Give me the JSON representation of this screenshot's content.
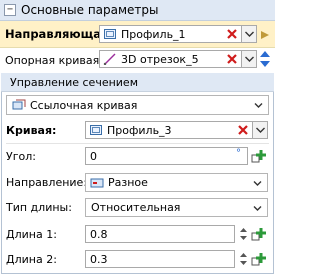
{
  "header": {
    "toggle_glyph": "−",
    "title": "Основные параметры"
  },
  "path": {
    "label": "Направляющая:",
    "value": "Профиль_1"
  },
  "reference_curve": {
    "label": "Опорная кривая:",
    "value": "3D отрезок_5"
  },
  "section": {
    "title": "Управление сечением",
    "mode_value": "Ссылочная кривая",
    "curve": {
      "label": "Кривая:",
      "value": "Профиль_3"
    },
    "angle": {
      "label": "Угол:",
      "value": "0",
      "unit": "°"
    },
    "direction": {
      "label": "Направление:",
      "value": "Разное"
    },
    "length_type": {
      "label": "Тип длины:",
      "value": "Относительная"
    },
    "length1": {
      "label": "Длина 1:",
      "value": "0.8"
    },
    "length2": {
      "label": "Длина 2:",
      "value": "0.3"
    }
  },
  "colors": {
    "header_bg": "#dfe8f4",
    "highlight_bg": "#fff1c7",
    "clear_red": "#d01c1c",
    "link_green": "#2c9a3a",
    "swap_blue": "#2a6bd1"
  }
}
